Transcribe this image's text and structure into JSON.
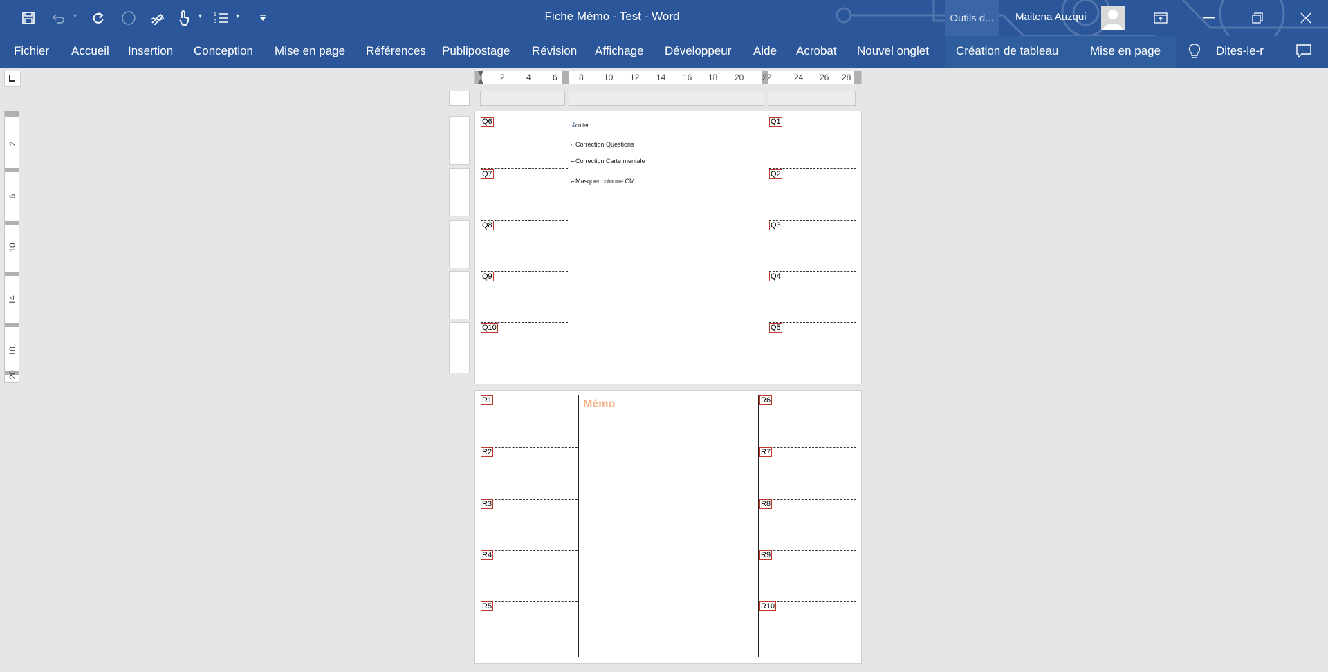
{
  "window": {
    "title": "Fiche Mémo - Test  -  Word",
    "contextual_tools": "Outils d...",
    "user_name": "Maitena Auzqui"
  },
  "quick_access": [
    "save-icon",
    "undo-icon",
    "redo-icon",
    "circle-icon",
    "ink-icon",
    "touch-icon",
    "numbering-icon",
    "customize-icon"
  ],
  "ribbon_tabs": [
    "Fichier",
    "Accueil",
    "Insertion",
    "Conception",
    "Mise en page",
    "Références",
    "Publipostage",
    "Révision",
    "Affichage",
    "Développeur",
    "Aide",
    "Acrobat",
    "Nouvel onglet",
    "Création de tableau",
    "Mise en page"
  ],
  "tell_me": "Dites-le-r",
  "ruler": {
    "h_numbers": [
      "2",
      "4",
      "6",
      "8",
      "10",
      "12",
      "14",
      "16",
      "18",
      "20",
      "22",
      "24",
      "26",
      "28"
    ],
    "v_numbers": [
      "2",
      "6",
      "10",
      "14",
      "18",
      "20"
    ]
  },
  "page1": {
    "left_labels": [
      "Q6",
      "Q7",
      "Q8",
      "Q9",
      "Q10"
    ],
    "right_labels": [
      "Q1",
      "Q2",
      "Q3",
      "Q4",
      "Q5"
    ],
    "items": [
      "coller",
      "Correction Questions",
      "Correction Carte mentale",
      "Masquer colonne CM"
    ]
  },
  "page2": {
    "title": "Mémo",
    "left_labels": [
      "R1",
      "R2",
      "R3",
      "R4",
      "R5"
    ],
    "right_labels": [
      "R6",
      "R7",
      "R8",
      "R9",
      "R10"
    ]
  },
  "colors": {
    "ribbon": "#2b579a",
    "memo": "#f4b183",
    "label_border": "#c0392b"
  }
}
